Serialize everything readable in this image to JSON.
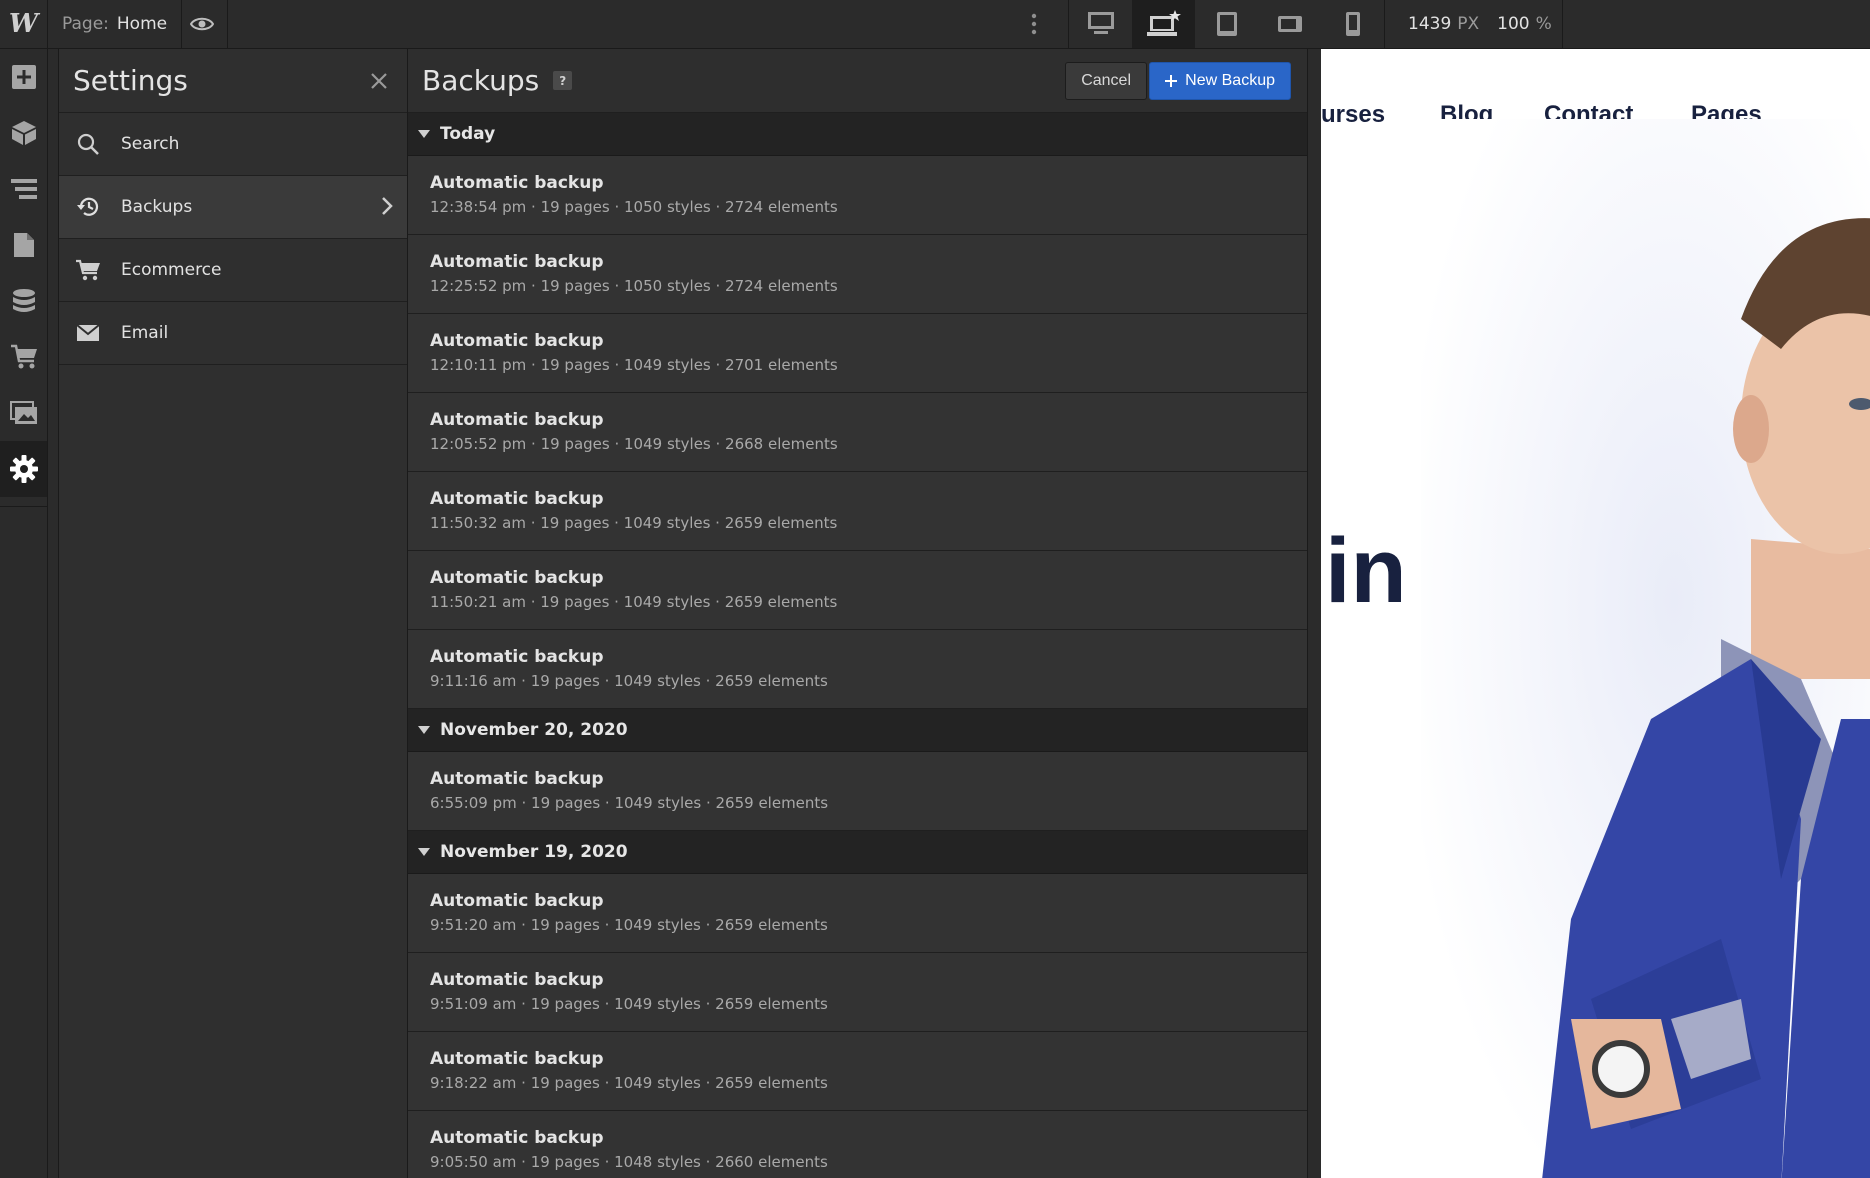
{
  "topbar": {
    "logo": "W",
    "page_label": "Page:",
    "page_value": "Home",
    "width_value": "1439",
    "width_unit": "PX",
    "zoom_value": "100",
    "zoom_unit": "%",
    "breakpoints": [
      "desktop-icon",
      "laptop-star-icon",
      "tablet-icon",
      "mobile-landscape-icon",
      "mobile-portrait-icon"
    ]
  },
  "rail": {
    "items": [
      "add-icon",
      "components-icon",
      "navigator-icon",
      "pages-icon",
      "cms-icon",
      "ecommerce-icon",
      "assets-icon",
      "settings-icon"
    ]
  },
  "settings": {
    "title": "Settings",
    "items": [
      {
        "label": "Search",
        "icon": "search-icon"
      },
      {
        "label": "Backups",
        "icon": "history-icon"
      },
      {
        "label": "Ecommerce",
        "icon": "cart-icon"
      },
      {
        "label": "Email",
        "icon": "mail-icon"
      }
    ]
  },
  "backups": {
    "title": "Backups",
    "help": "?",
    "cancel_label": "Cancel",
    "new_label": "New Backup",
    "groups": [
      {
        "label": "Today",
        "rows": [
          {
            "name": "Automatic backup",
            "meta": "12:38:54 pm · 19 pages · 1050 styles · 2724 elements"
          },
          {
            "name": "Automatic backup",
            "meta": "12:25:52 pm · 19 pages · 1050 styles · 2724 elements"
          },
          {
            "name": "Automatic backup",
            "meta": "12:10:11 pm · 19 pages · 1049 styles · 2701 elements"
          },
          {
            "name": "Automatic backup",
            "meta": "12:05:52 pm · 19 pages · 1049 styles · 2668 elements"
          },
          {
            "name": "Automatic backup",
            "meta": "11:50:32 am · 19 pages · 1049 styles · 2659 elements"
          },
          {
            "name": "Automatic backup",
            "meta": "11:50:21 am · 19 pages · 1049 styles · 2659 elements"
          },
          {
            "name": "Automatic backup",
            "meta": "9:11:16 am · 19 pages · 1049 styles · 2659 elements"
          }
        ]
      },
      {
        "label": "November 20, 2020",
        "rows": [
          {
            "name": "Automatic backup",
            "meta": "6:55:09 pm · 19 pages · 1049 styles · 2659 elements"
          }
        ]
      },
      {
        "label": "November 19, 2020",
        "rows": [
          {
            "name": "Automatic backup",
            "meta": "9:51:20 am · 19 pages · 1049 styles · 2659 elements"
          },
          {
            "name": "Automatic backup",
            "meta": "9:51:09 am · 19 pages · 1049 styles · 2659 elements"
          },
          {
            "name": "Automatic backup",
            "meta": "9:18:22 am · 19 pages · 1049 styles · 2659 elements"
          },
          {
            "name": "Automatic backup",
            "meta": "9:05:50 am · 19 pages · 1048 styles · 2660 elements"
          }
        ]
      }
    ]
  },
  "canvas": {
    "nav": [
      "urses",
      "Blog",
      "Contact",
      "Pages"
    ],
    "hero_fragment": "in"
  },
  "colors": {
    "accent": "#2a66c8",
    "nav_text": "#18213f",
    "panel_bg": "#2e2e2e"
  }
}
